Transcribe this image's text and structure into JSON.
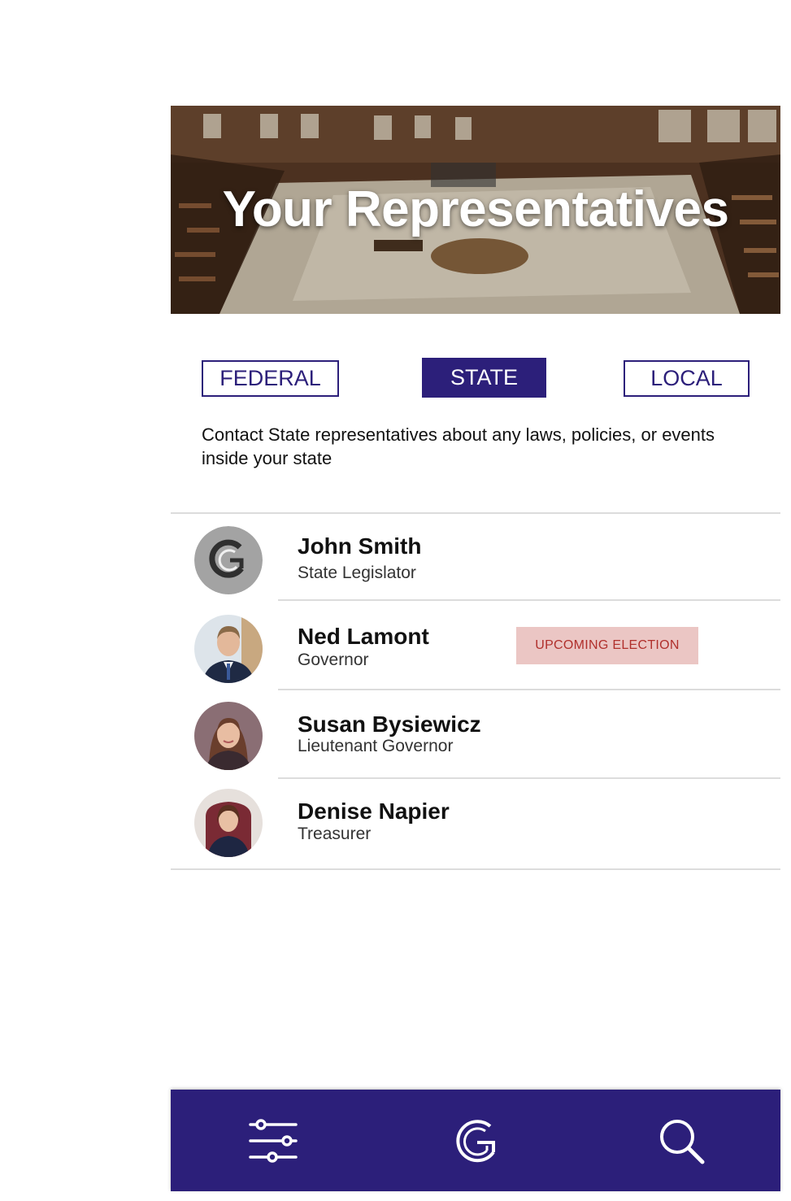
{
  "hero": {
    "title": "Your Representatives"
  },
  "tabs": [
    {
      "label": "FEDERAL",
      "active": false
    },
    {
      "label": "STATE",
      "active": true
    },
    {
      "label": "LOCAL",
      "active": false
    }
  ],
  "description": "Contact State representatives about any laws, policies, or events inside your state",
  "representatives": [
    {
      "name": "John Smith",
      "title": "State Legislator",
      "avatar": "logo-placeholder"
    },
    {
      "name": "Ned Lamont",
      "title": "Governor",
      "avatar": "photo",
      "badge": "UPCOMING ELECTION"
    },
    {
      "name": "Susan Bysiewicz",
      "title": "Lieutenant Governor",
      "avatar": "photo"
    },
    {
      "name": "Denise Napier",
      "title": "Treasurer",
      "avatar": "photo"
    }
  ],
  "bottom_nav": [
    {
      "icon": "filter-sliders-icon"
    },
    {
      "icon": "app-logo-icon"
    },
    {
      "icon": "search-icon"
    }
  ],
  "colors": {
    "primary": "#2c1f7a",
    "badge_bg": "#ebc6c4",
    "badge_text": "#b0302c",
    "divider": "#dcdcdc"
  }
}
